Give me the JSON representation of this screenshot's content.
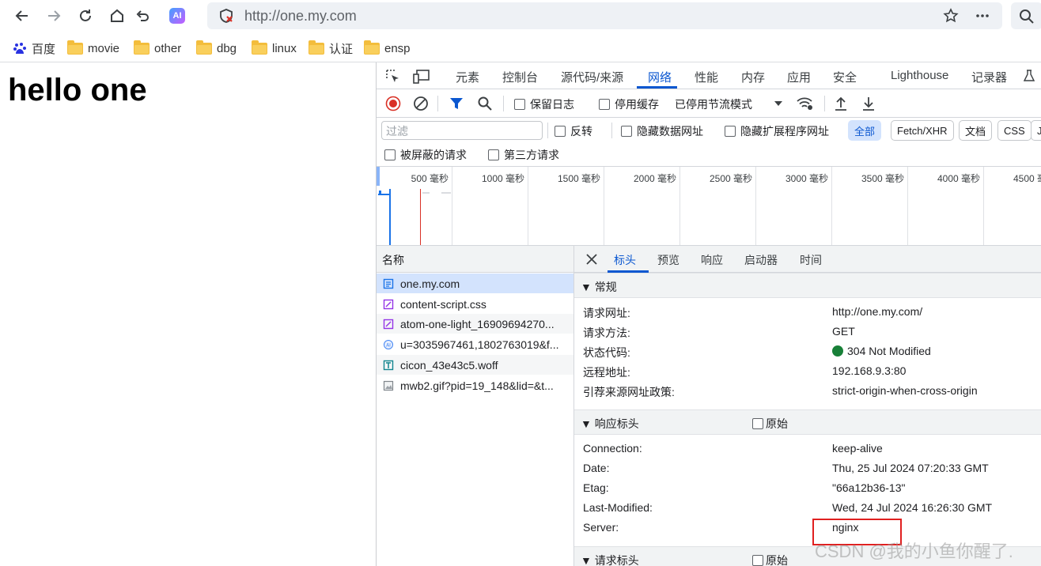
{
  "browser": {
    "url": "http://one.my.com",
    "ai_badge": "AI"
  },
  "bookmarks": [
    {
      "label": "百度",
      "icon": "baidu-icon"
    },
    {
      "label": "movie",
      "icon": "folder-icon"
    },
    {
      "label": "other",
      "icon": "folder-icon"
    },
    {
      "label": "dbg",
      "icon": "folder-icon"
    },
    {
      "label": "linux",
      "icon": "folder-icon"
    },
    {
      "label": "认证",
      "icon": "folder-icon"
    },
    {
      "label": "ensp",
      "icon": "folder-icon"
    }
  ],
  "page": {
    "heading": "hello one"
  },
  "devtools": {
    "tabs": [
      "元素",
      "控制台",
      "源代码/来源",
      "网络",
      "性能",
      "内存",
      "应用",
      "安全",
      "Lighthouse",
      "记录器"
    ],
    "active_tab": "网络",
    "net_toolbar": {
      "preserve_log": "保留日志",
      "disable_cache": "停用缓存",
      "throttling": "已停用节流模式"
    },
    "filter": {
      "placeholder": "过滤",
      "invert": "反转",
      "hide_data_urls": "隐藏数据网址",
      "hide_ext_urls": "隐藏扩展程序网址",
      "types": [
        "全部",
        "Fetch/XHR",
        "文档",
        "CSS",
        "J"
      ],
      "active_type": "全部",
      "blocked_requests": "被屏蔽的请求",
      "third_party": "第三方请求"
    },
    "timeline_ticks": [
      "500 毫秒",
      "1000 毫秒",
      "1500 毫秒",
      "2000 毫秒",
      "2500 毫秒",
      "3000 毫秒",
      "3500 毫秒",
      "4000 毫秒",
      "4500 毫秒"
    ],
    "name_header": "名称",
    "requests": [
      {
        "name": "one.my.com",
        "icon": "document-icon",
        "color": "#1a73e8"
      },
      {
        "name": "content-script.css",
        "icon": "stylesheet-icon",
        "color": "#9334e6"
      },
      {
        "name": "atom-one-light_16909694270...",
        "icon": "stylesheet-icon",
        "color": "#9334e6"
      },
      {
        "name": "u=3035967461,1802763019&f...",
        "icon": "image-icon",
        "color": "#4285f4"
      },
      {
        "name": "cicon_43e43c5.woff",
        "icon": "font-icon",
        "color": "#12858f"
      },
      {
        "name": "mwb2.gif?pid=19_148&lid=&t...",
        "icon": "image-icon",
        "color": "#80868b"
      }
    ],
    "detail_tabs": [
      "标头",
      "预览",
      "响应",
      "启动器",
      "时间"
    ],
    "active_detail_tab": "标头",
    "general": {
      "title": "▼ 常规",
      "rows": [
        {
          "key": "请求网址:",
          "value": "http://one.my.com/"
        },
        {
          "key": "请求方法:",
          "value": "GET"
        },
        {
          "key": "状态代码:",
          "value": "304 Not Modified"
        },
        {
          "key": "远程地址:",
          "value": "192.168.9.3:80"
        },
        {
          "key": "引荐来源网址政策:",
          "value": "strict-origin-when-cross-origin"
        }
      ]
    },
    "response_headers": {
      "title": "▼ 响应标头",
      "raw": "原始",
      "rows": [
        {
          "key": "Connection:",
          "value": "keep-alive"
        },
        {
          "key": "Date:",
          "value": "Thu, 25 Jul 2024 07:20:33 GMT"
        },
        {
          "key": "Etag:",
          "value": "\"66a12b36-13\""
        },
        {
          "key": "Last-Modified:",
          "value": "Wed, 24 Jul 2024 16:26:30 GMT"
        },
        {
          "key": "Server:",
          "value": "nginx"
        }
      ]
    },
    "request_headers": {
      "title": "▼ 请求标头",
      "raw": "原始"
    }
  },
  "watermark": "CSDN @我的小鱼你醒了."
}
